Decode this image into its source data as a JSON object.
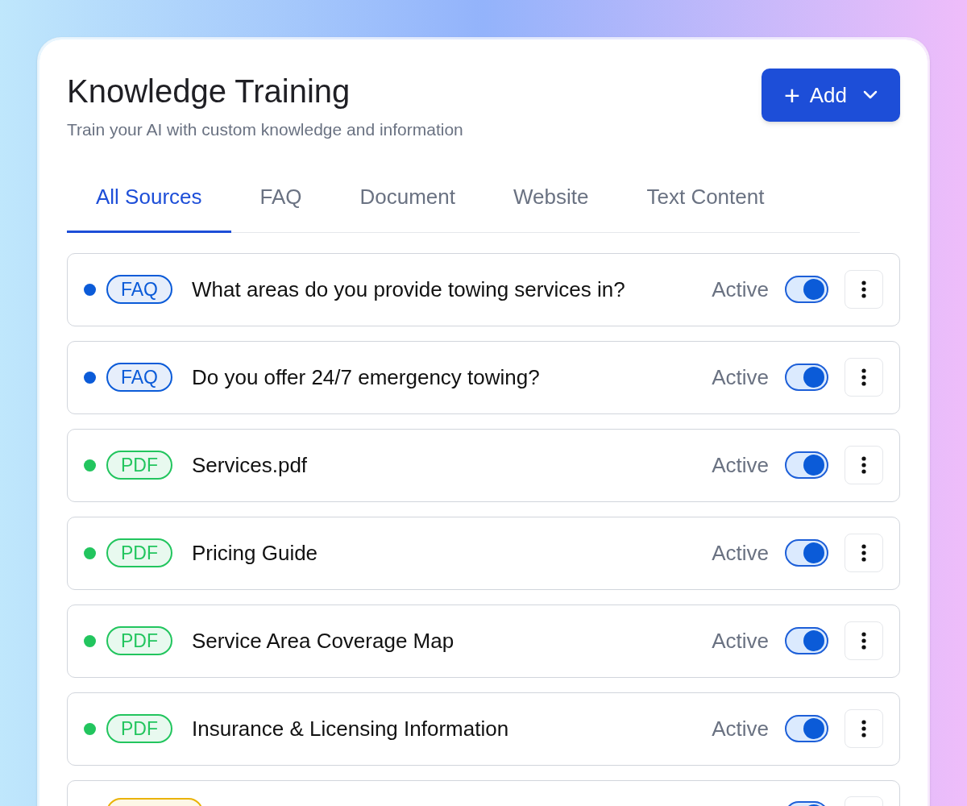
{
  "header": {
    "title": "Knowledge Training",
    "subtitle": "Train your AI with custom knowledge and information",
    "add_button": {
      "icon": "+",
      "label": "Add"
    }
  },
  "tabs": [
    {
      "label": "All Sources",
      "selected": true
    },
    {
      "label": "FAQ",
      "selected": false
    },
    {
      "label": "Document",
      "selected": false
    },
    {
      "label": "Website",
      "selected": false
    },
    {
      "label": "Text Content",
      "selected": false
    }
  ],
  "sources": [
    {
      "kind": "full",
      "tag": "FAQ",
      "color": "#0b5bd8",
      "title": "What areas do you provide towing services in?",
      "status": "Active",
      "on": true
    },
    {
      "kind": "full",
      "tag": "FAQ",
      "color": "#0b5bd8",
      "title": "Do you offer 24/7 emergency towing?",
      "status": "Active",
      "on": true
    },
    {
      "kind": "full",
      "tag": "PDF",
      "color": "#22c55e",
      "title": "Services.pdf",
      "status": "Active",
      "on": true
    },
    {
      "kind": "full",
      "tag": "PDF",
      "color": "#22c55e",
      "title": "Pricing Guide",
      "status": "Active",
      "on": true
    },
    {
      "kind": "full",
      "tag": "PDF",
      "color": "#22c55e",
      "title": "Service Area Coverage Map",
      "status": "Active",
      "on": true
    },
    {
      "kind": "full",
      "tag": "PDF",
      "color": "#22c55e",
      "title": "Insurance & Licensing Information",
      "status": "Active",
      "on": true
    },
    {
      "kind": "partial",
      "color": "#eab308",
      "on": true
    }
  ]
}
